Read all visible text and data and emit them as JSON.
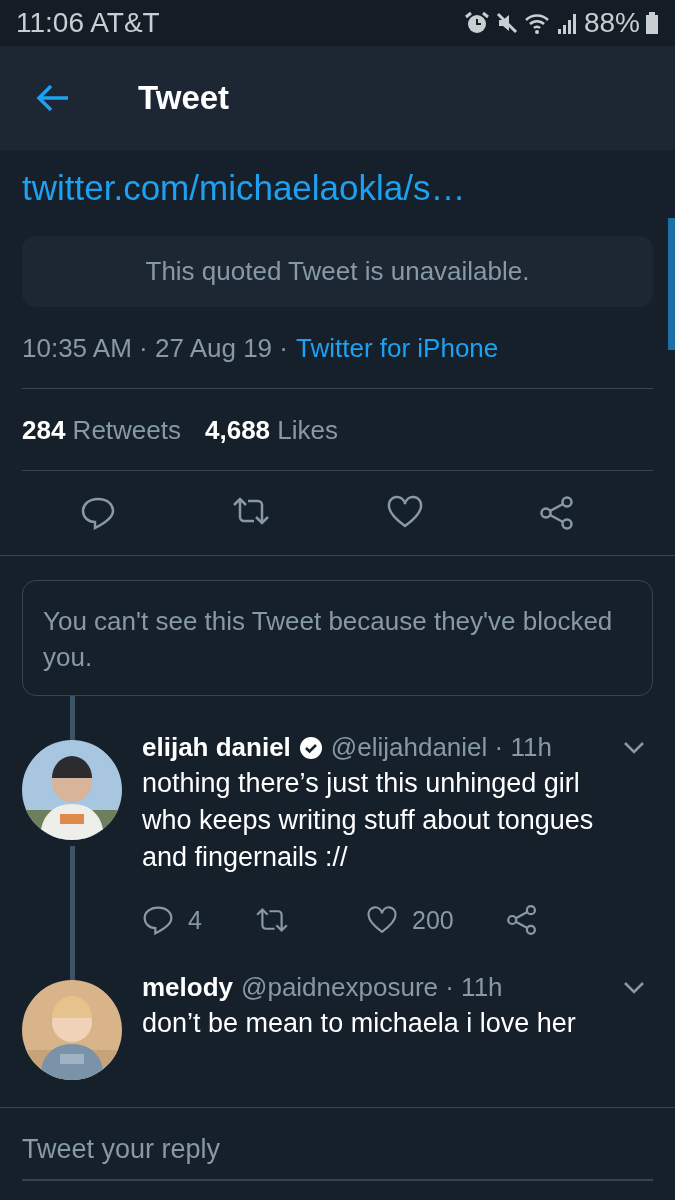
{
  "status_bar": {
    "time": "11:06",
    "carrier": "AT&T",
    "battery": "88%"
  },
  "header": {
    "title": "Tweet"
  },
  "tweet": {
    "link": "twitter.com/michaelaokla/s…",
    "quoted_notice": "This quoted Tweet is unavailable.",
    "timestamp": "10:35 AM · 27 Aug 19 ·",
    "source": "Twitter for iPhone",
    "retweets": "284",
    "retweets_label": "Retweets",
    "likes": "4,688",
    "likes_label": "Likes"
  },
  "blocked_notice": "You can't see this Tweet because they've blocked you.",
  "replies": [
    {
      "name": "elijah daniel",
      "verified": true,
      "handle_time": "@elijahdaniel · 11h",
      "text": "nothing there’s just this unhinged girl who keeps writing stuff about tongues and fingernails ://",
      "reply_count": "4",
      "like_count": "200",
      "thread_line": true
    },
    {
      "name": "melody",
      "verified": false,
      "handle_time": "@paidnexposure · 11h",
      "text": "don’t be mean to michaela i love her",
      "thread_line": false
    }
  ],
  "reply_box": {
    "placeholder": "Tweet your reply"
  }
}
